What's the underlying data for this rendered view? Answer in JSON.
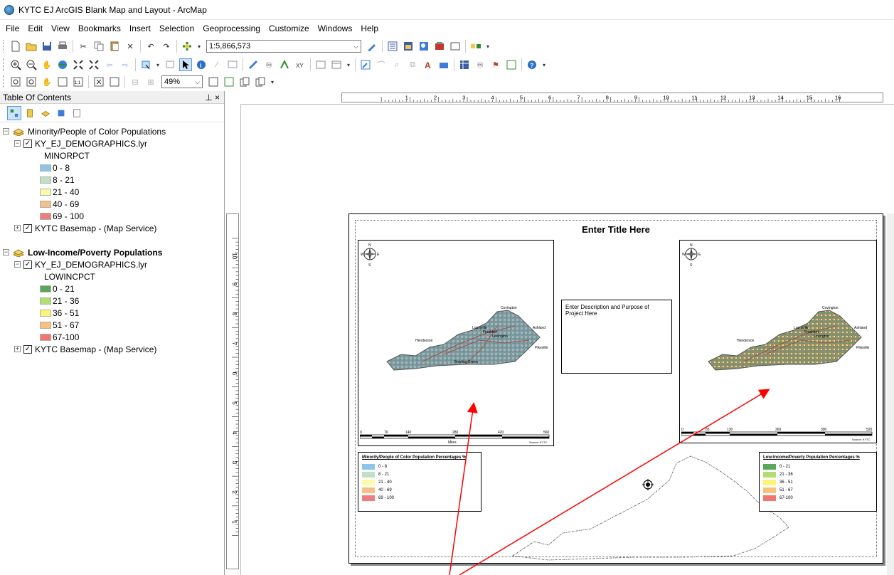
{
  "window": {
    "title": "KYTC EJ ArcGIS Blank Map and Layout - ArcMap"
  },
  "menu": [
    "File",
    "Edit",
    "View",
    "Bookmarks",
    "Insert",
    "Selection",
    "Geoprocessing",
    "Customize",
    "Windows",
    "Help"
  ],
  "toolbar": {
    "scale_value": "1:5,866,573",
    "zoom_value": "49%"
  },
  "toc": {
    "title": "Table Of Contents",
    "pin": "⊥ ×",
    "groups": [
      {
        "name": "Minority/People of Color Populations",
        "layer": "KY_EJ_DEMOGRAPHICS.lyr",
        "field": "MINORPCT",
        "classes": [
          {
            "label": "0 - 8",
            "color": "#8fc4e8"
          },
          {
            "label": "8 - 21",
            "color": "#bfe0c4"
          },
          {
            "label": "21 - 40",
            "color": "#fdfaa9"
          },
          {
            "label": "40 - 69",
            "color": "#f5bf87"
          },
          {
            "label": "69 - 100",
            "color": "#f07d7d"
          }
        ],
        "basemap": "KYTC Basemap - (Map Service)"
      },
      {
        "name": "Low-Income/Poverty Populations",
        "layer": "KY_EJ_DEMOGRAPHICS.lyr",
        "field": "LOWINCPCT",
        "classes": [
          {
            "label": "0 - 21",
            "color": "#5aa65a"
          },
          {
            "label": "21 - 36",
            "color": "#b2dd72"
          },
          {
            "label": "36 - 51",
            "color": "#fbf67a"
          },
          {
            "label": "51 - 67",
            "color": "#f9c27a"
          },
          {
            "label": "67-100",
            "color": "#f2766c"
          }
        ],
        "basemap": "KYTC Basemap - (Map Service)"
      }
    ]
  },
  "ruler_top": [
    "1",
    "2",
    "3",
    "4",
    "5",
    "6",
    "7",
    "8",
    "9",
    "10",
    "11",
    "12",
    "13",
    "14",
    "15",
    "16"
  ],
  "ruler_left": [
    "10",
    "9",
    "8",
    "7",
    "6",
    "5",
    "4",
    "3",
    "2",
    "1"
  ],
  "layout": {
    "title": "Enter Title Here",
    "description": "Enter Description and Purpose of Project Here",
    "left_map": {
      "scale_ticks": [
        "0",
        "70",
        "140",
        "280",
        "420",
        "560"
      ],
      "scale_unit": "Miles",
      "source": "Source: KYTC",
      "cities": [
        "Covington",
        "Ashland",
        "Louisville",
        "Lexington",
        "Frankfort",
        "Henderson",
        "Pikeville",
        "Bowling Green"
      ]
    },
    "right_map": {
      "scale_ticks": [
        "0",
        "65",
        "130",
        "260",
        "390",
        "520"
      ],
      "scale_unit": "Miles",
      "source": "Source: KYTC",
      "cities": [
        "Covington",
        "Ashland",
        "Louisville",
        "Lexington",
        "Frankfort",
        "Henderson",
        "Pikeville"
      ]
    },
    "compass_letters": {
      "n": "N",
      "s": "S",
      "e": "E",
      "w": "W"
    },
    "legend_left": {
      "title": "Minority/People of Color Population Percentages %",
      "items": [
        {
          "label": "0 - 8",
          "color": "#8fc4e8"
        },
        {
          "label": "8 - 21",
          "color": "#bfe0c4"
        },
        {
          "label": "21 - 40",
          "color": "#fdfaa9"
        },
        {
          "label": "40 - 69",
          "color": "#f5bf87"
        },
        {
          "label": "69 - 100",
          "color": "#f07d7d"
        }
      ]
    },
    "legend_right": {
      "title": "Low-Income/Poverty Population Percentages %",
      "items": [
        {
          "label": "0 - 21",
          "color": "#5aa65a"
        },
        {
          "label": "21 - 36",
          "color": "#b2dd72"
        },
        {
          "label": "36 - 51",
          "color": "#fbf67a"
        },
        {
          "label": "51 - 67",
          "color": "#f9c27a"
        },
        {
          "label": "67-100",
          "color": "#f2766c"
        }
      ]
    }
  },
  "annotation_color": "#ff0000"
}
